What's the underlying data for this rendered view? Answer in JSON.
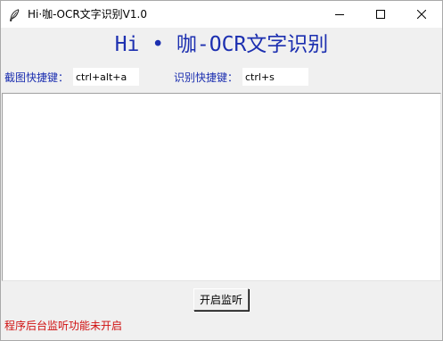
{
  "window": {
    "title": "Hi·咖-OCR文字识别V1.0",
    "icon": "feather-icon",
    "controls": [
      "minimize-icon",
      "maximize-icon",
      "close-icon"
    ]
  },
  "app": {
    "heading": "Hi • 咖-OCR文字识别"
  },
  "hotkeys": {
    "screenshot_label": "截图快捷键：",
    "screenshot_value": "ctrl+alt+a",
    "recognize_label": "识别快捷键：",
    "recognize_value": "ctrl+s"
  },
  "result": {
    "text": ""
  },
  "actions": {
    "start_listening_label": "开启监听"
  },
  "status": {
    "message": "程序后台监听功能未开启",
    "color": "#d01010"
  },
  "colors": {
    "accent": "#1c2fb0",
    "background": "#f0f0f0"
  }
}
